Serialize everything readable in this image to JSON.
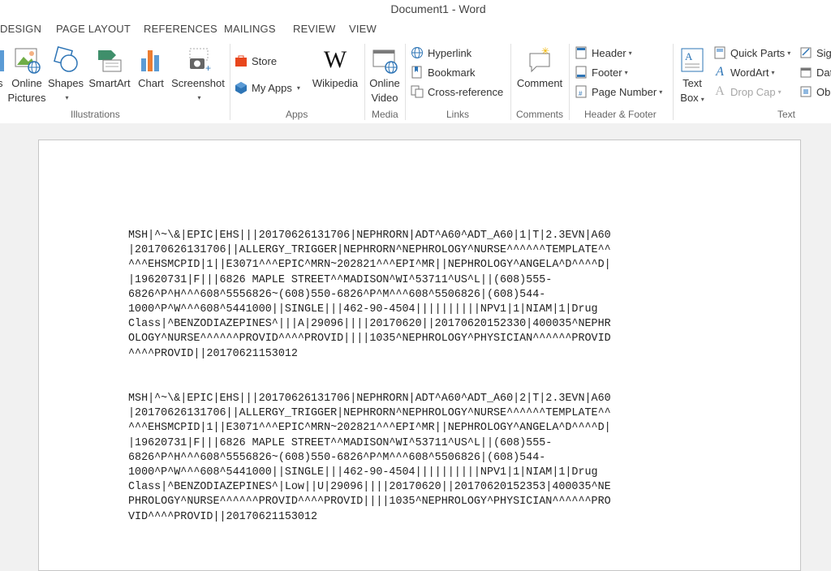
{
  "window": {
    "title": "Document1 - Word"
  },
  "tabs": [
    "DESIGN",
    "PAGE LAYOUT",
    "REFERENCES",
    "MAILINGS",
    "REVIEW",
    "VIEW"
  ],
  "ribbon": {
    "illustrations": {
      "label": "Illustrations",
      "items": [
        "Online",
        "Pictures",
        "Shapes",
        "SmartArt",
        "Chart",
        "Screenshot"
      ],
      "partial_left": "s"
    },
    "apps": {
      "label": "Apps",
      "store": "Store",
      "my_apps": "My Apps",
      "wikipedia": "Wikipedia"
    },
    "media": {
      "label": "Media",
      "online": "Online",
      "video": "Video"
    },
    "links": {
      "label": "Links",
      "hyperlink": "Hyperlink",
      "bookmark": "Bookmark",
      "cross_reference": "Cross-reference"
    },
    "comments": {
      "label": "Comments",
      "comment": "Comment"
    },
    "header_footer": {
      "label": "Header & Footer",
      "header": "Header",
      "footer": "Footer",
      "page_number": "Page Number"
    },
    "text": {
      "label": "Text",
      "text": "Text",
      "box": "Box",
      "quick_parts": "Quick Parts",
      "wordart": "WordArt",
      "drop_cap": "Drop Cap",
      "sig": "Sig",
      "dat": "Dat",
      "obj": "Ob"
    }
  },
  "document": {
    "paragraphs": [
      [
        "MSH|^~\\&|EPIC|EHS|||20170626131706|NEPHRORN|ADT^A60^ADT_A60|1|T|2.3EVN|A60",
        "|20170626131706||ALLERGY_TRIGGER|NEPHRORN^NEPHROLOGY^NURSE^^^^^^TEMPLATE^^",
        "^^^EHSMCPID|1||E3071^^^EPIC^MRN~202821^^^EPI^MR||NEPHROLOGY^ANGELA^D^^^^D|",
        "|19620731|F|||6826 MAPLE STREET^^MADISON^WI^53711^US^L||(608)555-",
        "6826^P^H^^^608^5556826~(608)550-6826^P^M^^^608^5506826|(608)544-",
        "1000^P^W^^^608^5441000||SINGLE|||462-90-4504||||||||||NPV1|1|NIAM|1|Drug",
        "Class|^BENZODIAZEPINES^|||A|29096||||20170620||20170620152330|400035^NEPHR",
        "OLOGY^NURSE^^^^^^PROVID^^^^PROVID||||1035^NEPHROLOGY^PHYSICIAN^^^^^^PROVID",
        "^^^^PROVID||20170621153012"
      ],
      [
        "MSH|^~\\&|EPIC|EHS|||20170626131706|NEPHRORN|ADT^A60^ADT_A60|2|T|2.3EVN|A60",
        "|20170626131706||ALLERGY_TRIGGER|NEPHRORN^NEPHROLOGY^NURSE^^^^^^TEMPLATE^^",
        "^^^EHSMCPID|1||E3071^^^EPIC^MRN~202821^^^EPI^MR||NEPHROLOGY^ANGELA^D^^^^D|",
        "|19620731|F|||6826 MAPLE STREET^^MADISON^WI^53711^US^L||(608)555-",
        "6826^P^H^^^608^5556826~(608)550-6826^P^M^^^608^5506826|(608)544-",
        "1000^P^W^^^608^5441000||SINGLE|||462-90-4504||||||||||NPV1|1|NIAM|1|Drug",
        "Class|^BENZODIAZEPINES^|Low||U|29096||||20170620||20170620152353|400035^NE",
        "PHROLOGY^NURSE^^^^^^PROVID^^^^PROVID||||1035^NEPHROLOGY^PHYSICIAN^^^^^^PRO",
        "VID^^^^PROVID||20170621153012"
      ]
    ]
  }
}
